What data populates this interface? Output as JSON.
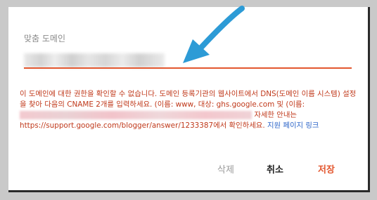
{
  "dialog": {
    "field_label": "맞춤 도메인",
    "error_text_1": "이 도메인에 대한 권한을 확인할 수 없습니다. 도메인 등록기관의 웹사이트에서 DNS(도메인 이름 시스템) 설정을 찾아 다음의 CNAME 2개를 입력하세요. (이름: www, 대상: ghs.google.com 및 (이름:",
    "error_text_2": "자세한 안내는 https://support.google.com/blogger/answer/1233387에서 확인하세요.",
    "help_link": "지원 페이지 링크",
    "colors": {
      "accent": "#e3572f",
      "error": "#c0391b",
      "link": "#2f67c9",
      "arrow": "#2d9bd6"
    }
  },
  "actions": {
    "delete_label": "삭제",
    "cancel_label": "취소",
    "save_label": "저장"
  }
}
